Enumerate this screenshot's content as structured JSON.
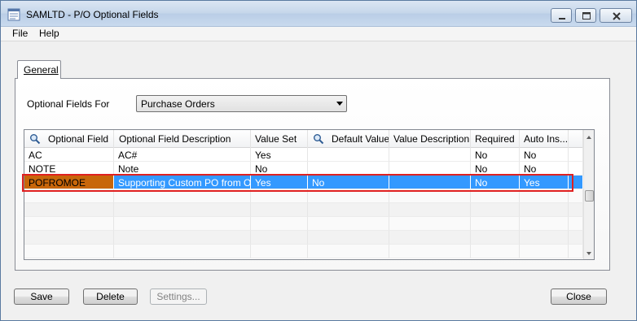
{
  "window": {
    "title": "SAMLTD - P/O Optional Fields"
  },
  "menu": {
    "file": "File",
    "help": "Help"
  },
  "tabs": [
    {
      "label": "General"
    }
  ],
  "form": {
    "optional_fields_for_label": "Optional Fields For",
    "optional_fields_for_value": "Purchase Orders"
  },
  "grid": {
    "columns": [
      {
        "label": "Optional Field",
        "icon": "search-icon"
      },
      {
        "label": "Optional Field Description"
      },
      {
        "label": "Value Set"
      },
      {
        "label": "Default Value",
        "icon": "search-icon"
      },
      {
        "label": "Value Description"
      },
      {
        "label": "Required"
      },
      {
        "label": "Auto Ins..."
      }
    ],
    "rows": [
      [
        "AC",
        "AC#",
        "Yes",
        "",
        "",
        "No",
        "No"
      ],
      [
        "NOTE",
        "Note",
        "No",
        "",
        "",
        "No",
        "No"
      ],
      [
        "POFROMOE",
        "Supporting Custom PO from OE",
        "Yes",
        "No",
        "",
        "No",
        "Yes"
      ]
    ],
    "selected_row": 2
  },
  "buttons": {
    "save": "Save",
    "delete": "Delete",
    "settings": "Settings...",
    "close": "Close"
  },
  "colors": {
    "selection": "#3399ff",
    "highlight_cell": "#c8660a",
    "annotation_box": "#e02020"
  }
}
